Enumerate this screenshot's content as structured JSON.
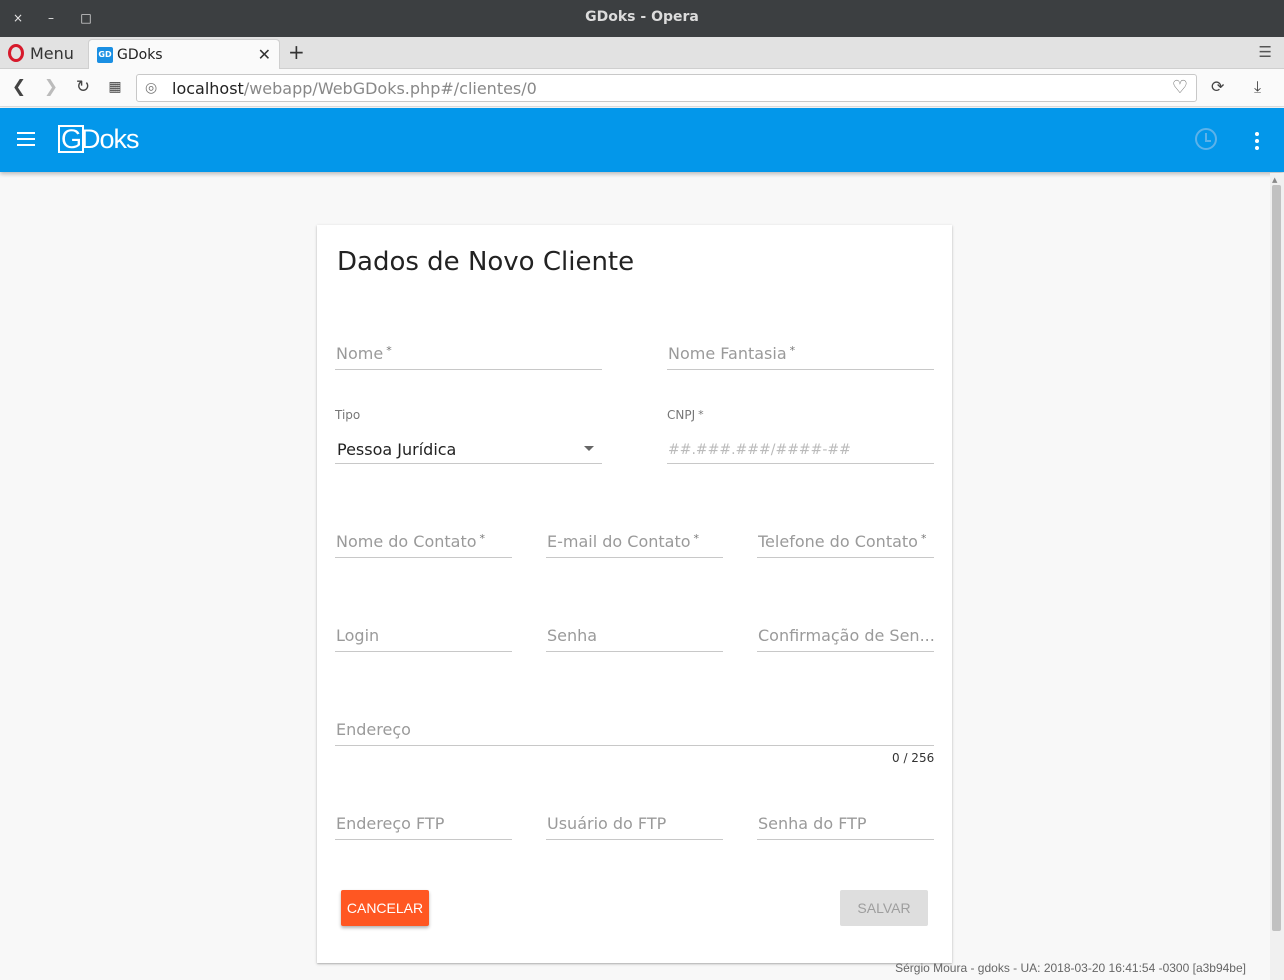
{
  "window": {
    "title": "GDoks - Opera",
    "close": "×",
    "minimize": "–",
    "maximize": "□"
  },
  "browser": {
    "menu_label": "Menu",
    "tab_title": "GDoks",
    "url_host": "localhost",
    "url_path": "/webapp/WebGDoks.php#/clientes/0"
  },
  "app": {
    "logo_g": "G",
    "logo_rest": "Doks"
  },
  "form": {
    "title": "Dados de Novo Cliente",
    "nome": {
      "placeholder": "Nome",
      "required": "*"
    },
    "nome_fantasia": {
      "placeholder": "Nome Fantasia",
      "required": "*"
    },
    "tipo": {
      "label": "Tipo",
      "value": "Pessoa Jurídica"
    },
    "cnpj": {
      "label": "CNPJ",
      "required": "*",
      "mask": "##.###.###/####-##"
    },
    "nome_contato": {
      "placeholder": "Nome do Contato",
      "required": "*"
    },
    "email_contato": {
      "placeholder": "E-mail do Contato",
      "required": "*"
    },
    "telefone_contato": {
      "placeholder": "Telefone do Contato",
      "required": "*"
    },
    "login": {
      "placeholder": "Login"
    },
    "senha": {
      "placeholder": "Senha"
    },
    "confirmacao_senha": {
      "placeholder": "Confirmação de Sen..."
    },
    "endereco": {
      "placeholder": "Endereço",
      "counter": "0 / 256"
    },
    "endereco_ftp": {
      "placeholder": "Endereço FTP"
    },
    "usuario_ftp": {
      "placeholder": "Usuário do FTP"
    },
    "senha_ftp": {
      "placeholder": "Senha do FTP"
    },
    "cancel_label": "CANCELAR",
    "save_label": "SALVAR"
  },
  "footer": {
    "text": "Sérgio Moura - gdoks - UA: 2018-03-20 16:41:54 -0300 [a3b94be]"
  },
  "colors": {
    "appbar": "#0397ea",
    "cancel": "#ff5722",
    "save_disabled": "#dedede"
  }
}
